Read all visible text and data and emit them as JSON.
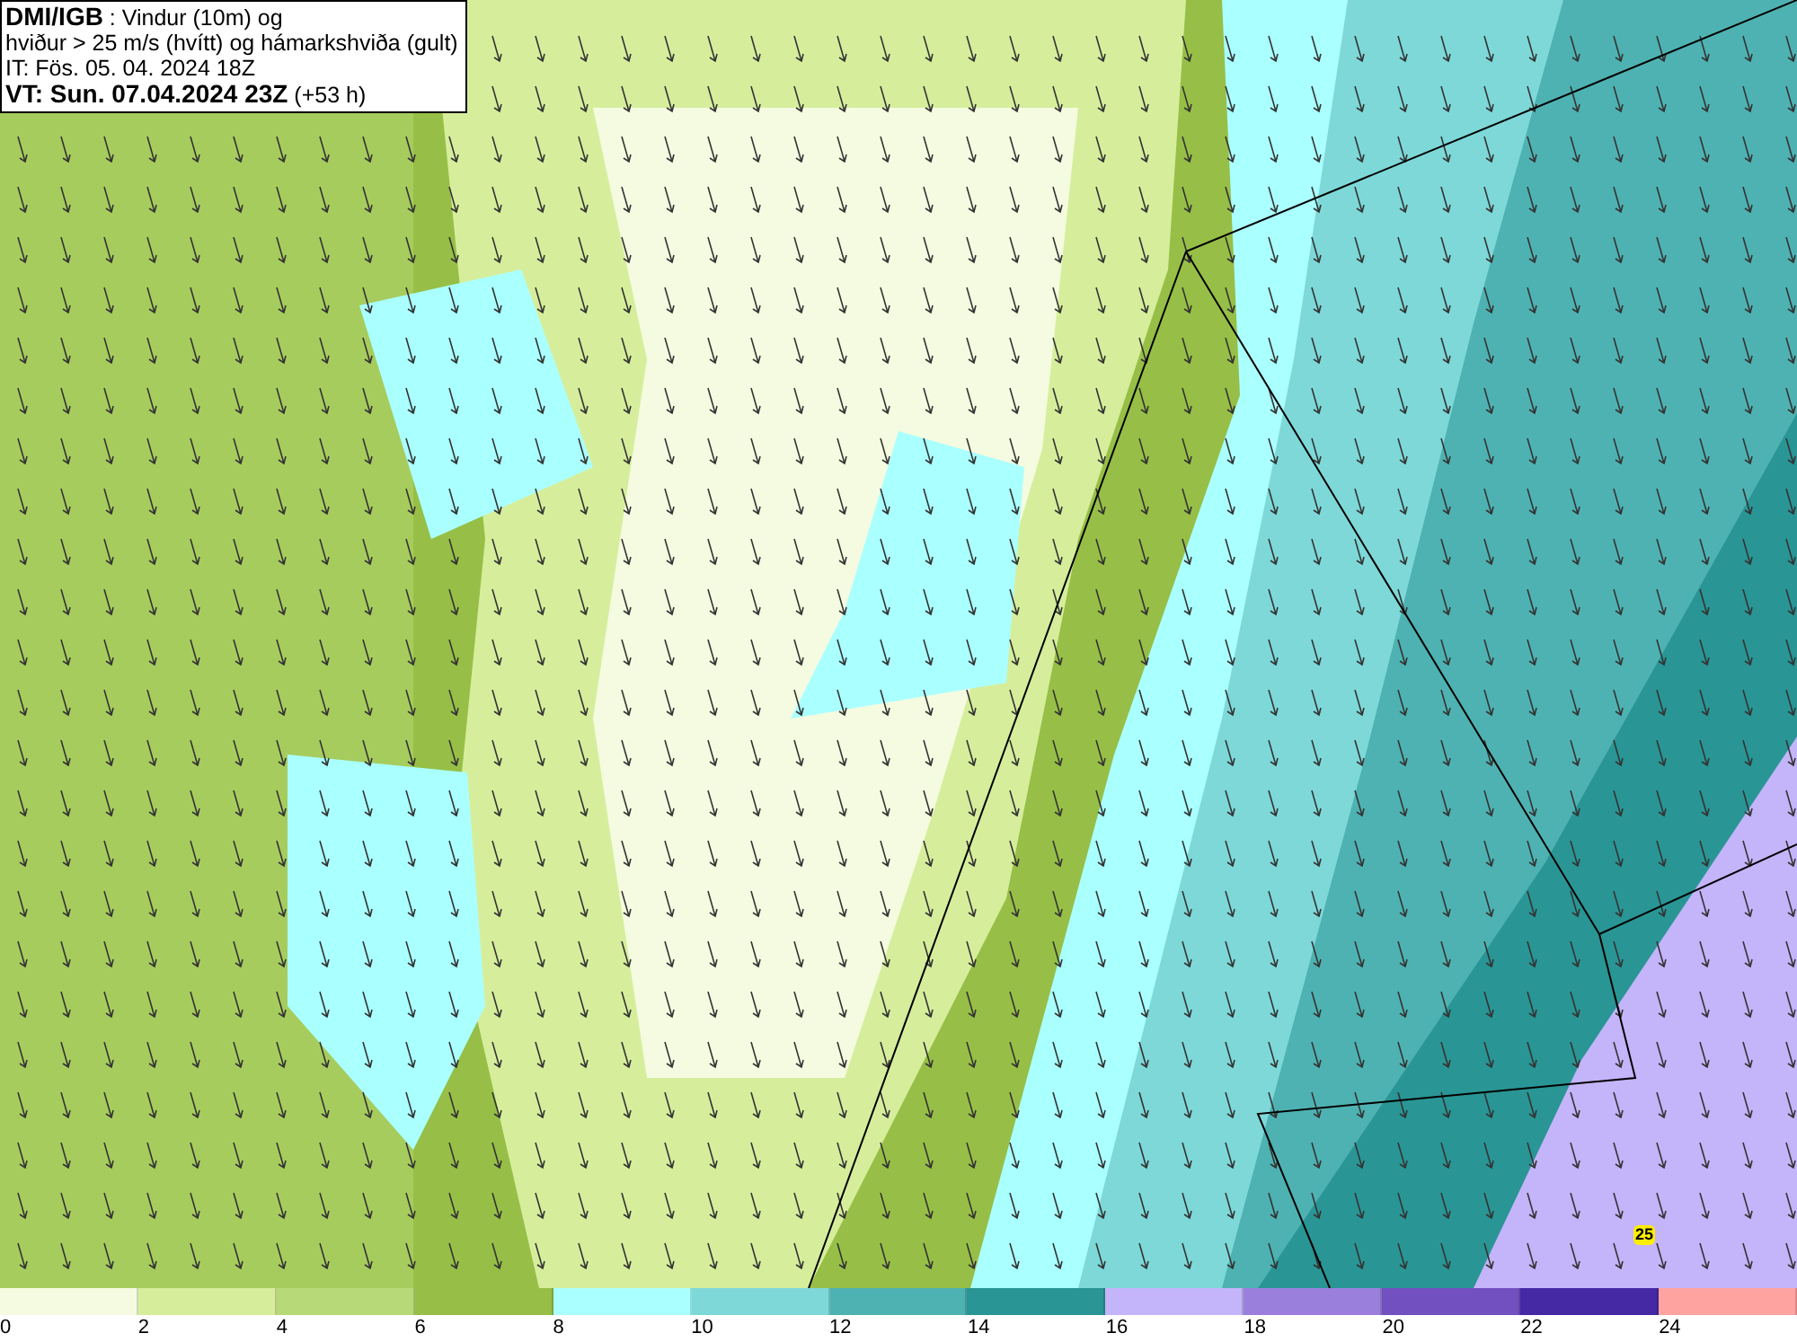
{
  "title_box": {
    "lines": [
      "**DMI/IGB** : Vindur (10m) og",
      "hviður > 25 m/s (hvítt) og hámarkshviða (gult)",
      "IT: Fös. 05. 04. 2024 18Z",
      "**VT: Sun. 07.04.2024 23Z** (+53 h)"
    ]
  },
  "map": {
    "gust_marker": "25"
  },
  "legend": {
    "bins": [
      {
        "label": "0",
        "color": "#f4fbe0"
      },
      {
        "label": "2",
        "color": "#d6ee9c"
      },
      {
        "label": "4",
        "color": "#b7d977"
      },
      {
        "label": "6",
        "color": "#97bf47"
      },
      {
        "label": "8",
        "color": "#aaffff"
      },
      {
        "label": "10",
        "color": "#7ed8d8"
      },
      {
        "label": "12",
        "color": "#4fb2b2"
      },
      {
        "label": "14",
        "color": "#2a9595"
      },
      {
        "label": "16",
        "color": "#c4b4fa"
      },
      {
        "label": "18",
        "color": "#9a80dc"
      },
      {
        "label": "20",
        "color": "#7250bf"
      },
      {
        "label": "22",
        "color": "#4428a4"
      },
      {
        "label": "24",
        "color": "#ffa3a0"
      }
    ]
  }
}
